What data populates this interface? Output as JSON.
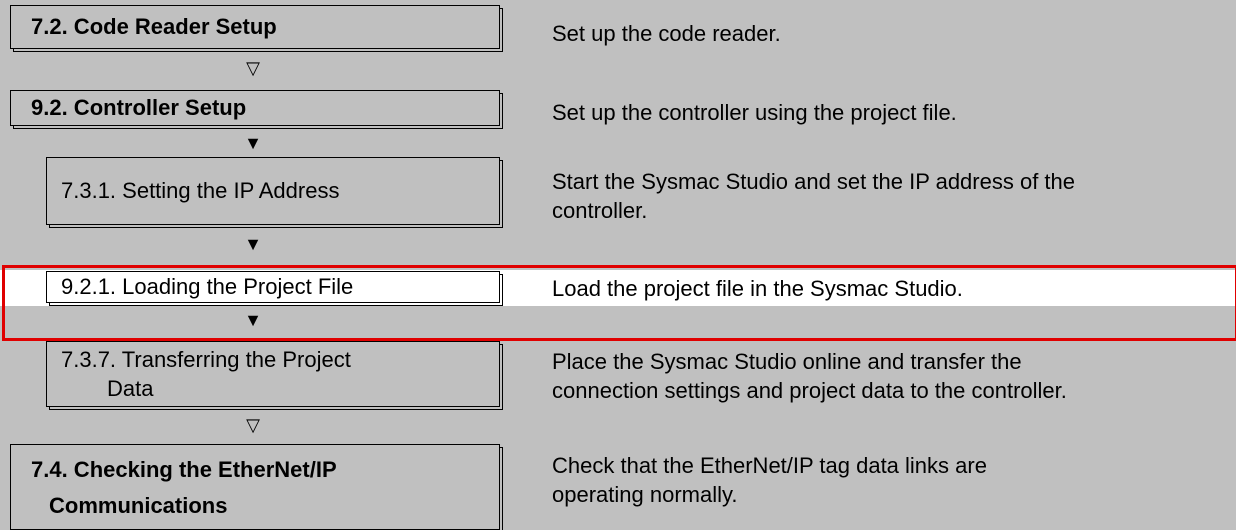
{
  "steps": [
    {
      "label": "7.2. Code Reader Setup",
      "description": "Set up the code reader."
    },
    {
      "label": "9.2. Controller Setup",
      "description": "Set up the controller using the project file."
    },
    {
      "label": "7.3.1. Setting the IP Address",
      "description_line1": "Start the Sysmac Studio and set the IP address of the",
      "description_line2": "controller."
    },
    {
      "label": "9.2.1. Loading the Project File",
      "description": "Load the project file in the Sysmac Studio."
    },
    {
      "label_line1": "7.3.7. Transferring the Project",
      "label_line2": "Data",
      "description_line1": "Place the Sysmac Studio online and transfer the",
      "description_line2": "connection settings and project data to the controller."
    },
    {
      "label_line1": "7.4. Checking the EtherNet/IP",
      "label_line2": "Communications",
      "description_line1": "Check that the EtherNet/IP tag data links are",
      "description_line2": "operating normally."
    }
  ],
  "arrows": {
    "hollow": "▽",
    "filled": "▼"
  },
  "colors": {
    "band": "#c0c0c0",
    "highlight": "#e00000"
  }
}
